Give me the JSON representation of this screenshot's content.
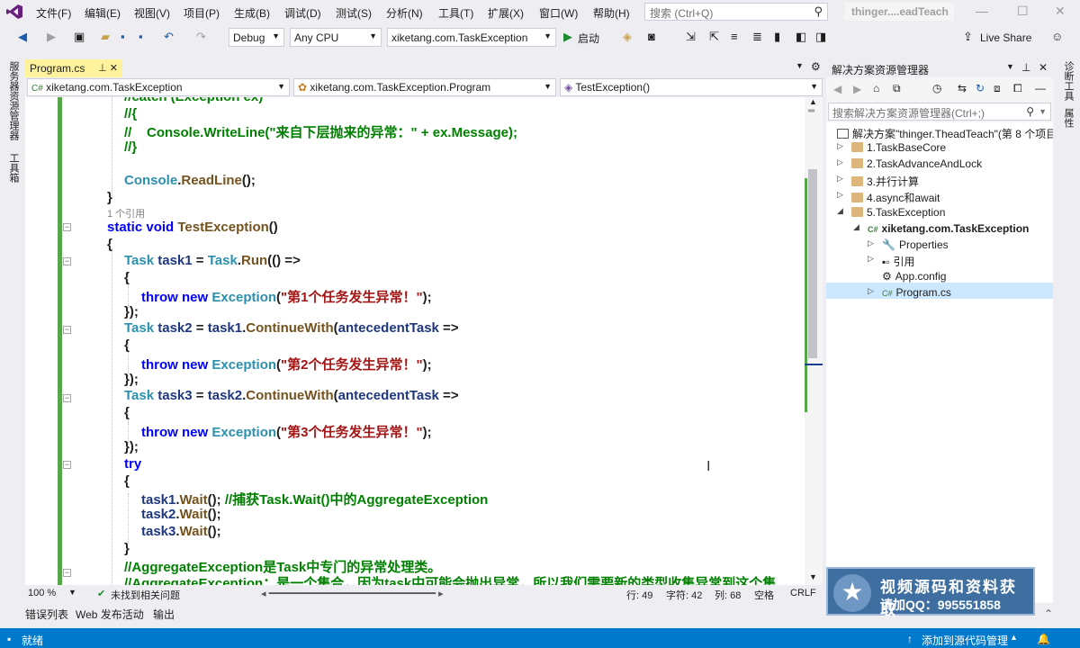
{
  "menu": [
    "文件(F)",
    "编辑(E)",
    "视图(V)",
    "项目(P)",
    "生成(B)",
    "调试(D)",
    "测试(S)",
    "分析(N)",
    "工具(T)",
    "扩展(X)",
    "窗口(W)",
    "帮助(H)"
  ],
  "search_placeholder": "搜索 (Ctrl+Q)",
  "window_title": "thinger....eadTeach",
  "toolbar": {
    "config": "Debug",
    "platform": "Any CPU",
    "startup": "xiketang.com.TaskException",
    "start": "启动",
    "live_share": "Live Share"
  },
  "left_strip": [
    "服务器资源管理器",
    "工具箱"
  ],
  "right_strip": [
    "诊断工具",
    "属性"
  ],
  "doc_tab": "Program.cs",
  "nav": {
    "project": "xiketang.com.TaskException",
    "class": "xiketang.com.TaskException.Program",
    "member": "TestException()"
  },
  "code": {
    "l1": "//catch (Exception ex)",
    "l2": "//{",
    "l3": "//    Console.WriteLine(\"来自下层抛来的异常：\" + ex.Message);",
    "l4": "//}",
    "l5a": "Console",
    "l5b": ".",
    "l5c": "ReadLine",
    "l5d": "();",
    "l6": "}",
    "ref": "1 个引用",
    "l7a": "static void ",
    "l7b": "TestException",
    "l7c": "()",
    "l8": "{",
    "t1a": "Task ",
    "t1b": "task1",
    "t1c": " = ",
    "t1d": "Task",
    "t1e": ".",
    "t1f": "Run",
    "t1g": "(() =>",
    "ob": "{",
    "thr": "throw new ",
    "exc": "Exception",
    "s1": "\"第1个任务发生异常！\"",
    "s2": "\"第2个任务发生异常！\"",
    "s3": "\"第3个任务发生异常！\"",
    "close": "});",
    "t2b": "task2",
    "t3b": "task3",
    "cw": "ContinueWith",
    "ant": "antecedentTask",
    "arrow": " =>",
    "try": "try",
    "w1": "task1",
    "wait": "Wait",
    "wcmt": "//捕获Task.Wait()中的AggregateException",
    "w2": "task2",
    "w3": "task3",
    "cb": "}",
    "c1": "//AggregateException是Task中专门的异常处理类。",
    "c2": "//AggregateException：是一个集合，因为task中可能会抛出异常，所以我们需要新的类型收集异常到这个集"
  },
  "status_line": {
    "zoom": "100 %",
    "issues": "未找到相关问题",
    "line": "行: 49",
    "char": "字符: 42",
    "col": "列: 68",
    "space": "空格",
    "eol": "CRLF"
  },
  "bottom_tabs": [
    "错误列表",
    "Web 发布活动",
    "输出"
  ],
  "status_bar": {
    "ready": "就绪",
    "source_control": "添加到源代码管理"
  },
  "solution_explorer": {
    "title": "解决方案资源管理器",
    "search": "搜索解决方案资源管理器(Ctrl+;)",
    "solution": "解决方案\"thinger.TheadTeach\"(第 8 个项目",
    "items": [
      "1.TaskBaseCore",
      "2.TaskAdvanceAndLock",
      "3.并行计算",
      "4.async和await",
      "5.TaskException"
    ],
    "project": "xiketang.com.TaskException",
    "children": [
      "Properties",
      "引用",
      "App.config",
      "Program.cs"
    ]
  },
  "overlay": {
    "line1": "视频源码和资料获取",
    "line2": "请加QQ：995551858"
  },
  "colors": {
    "accent": "#007ACC",
    "tab_active": "#FFF29D",
    "keyword": "#0000FF",
    "type": "#2B91AF",
    "string": "#A31515",
    "comment": "#008000"
  }
}
